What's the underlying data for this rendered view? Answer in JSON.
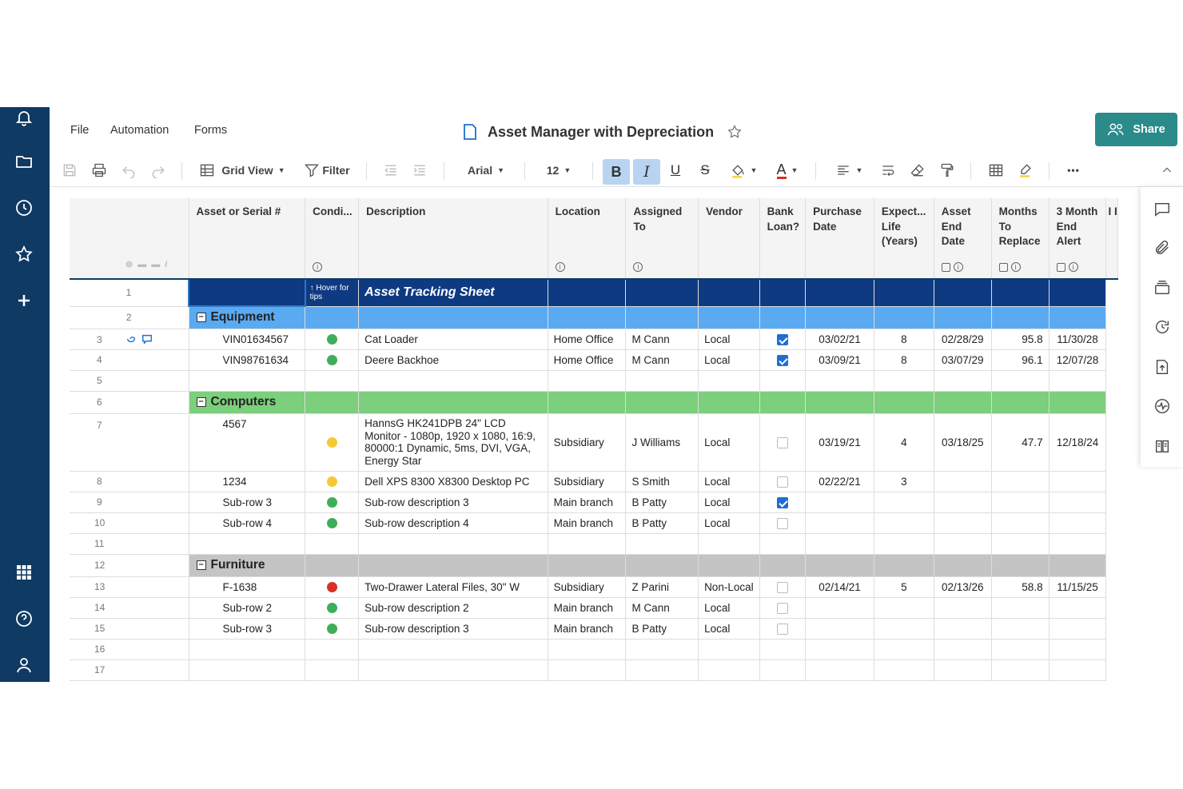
{
  "app": {
    "menu": [
      "File",
      "Automation",
      "Forms"
    ],
    "doc_title": "Asset Manager with Depreciation",
    "share_label": "Share"
  },
  "toolbar": {
    "view_label": "Grid View",
    "filter_label": "Filter",
    "font": "Arial",
    "font_size": "12",
    "bold": "B",
    "italic": "I",
    "underline": "U",
    "strike": "S",
    "text_color": "A",
    "more": "•••"
  },
  "columns": [
    "Asset or Serial #",
    "Condi...",
    "Description",
    "Location",
    "Assigned To",
    "Vendor",
    "Bank Loan?",
    "Purchase Date",
    "Expect... Life (Years)",
    "Asset End Date",
    "Months To Replace",
    "3 Month End Alert",
    "I I"
  ],
  "colors": {
    "nav_bg": "#0e3a63",
    "share_bg": "#2b8a8a",
    "title_row": "#0e3a82",
    "equipment": "#5aaaf2",
    "computers": "#7ccf7c",
    "furniture": "#c4c4c4",
    "green": "#3fae5a",
    "yellow": "#f5c933",
    "red": "#d93025"
  },
  "sheet": {
    "hover_tip": "↑ Hover for tips",
    "title": "Asset Tracking Sheet",
    "groups": {
      "equipment": "Equipment",
      "computers": "Computers",
      "furniture": "Furniture"
    },
    "rows": {
      "r3": {
        "asset": "VIN01634567",
        "cond": "green",
        "desc": "Cat Loader",
        "loc": "Home Office",
        "assigned": "M Cann",
        "vendor": "Local",
        "loan": true,
        "purchase": "03/02/21",
        "life": "8",
        "end": "02/28/29",
        "months": "95.8",
        "alert": "11/30/28"
      },
      "r4": {
        "asset": "VIN98761634",
        "cond": "green",
        "desc": "Deere Backhoe",
        "loc": "Home Office",
        "assigned": "M Cann",
        "vendor": "Local",
        "loan": true,
        "purchase": "03/09/21",
        "life": "8",
        "end": "03/07/29",
        "months": "96.1",
        "alert": "12/07/28"
      },
      "r7": {
        "asset": "4567",
        "cond": "yellow",
        "desc": "HannsG HK241DPB 24\" LCD Monitor - 1080p, 1920 x 1080, 16:9, 80000:1 Dynamic, 5ms, DVI, VGA, Energy Star",
        "loc": "Subsidiary",
        "assigned": "J Williams",
        "vendor": "Local",
        "loan": false,
        "purchase": "03/19/21",
        "life": "4",
        "end": "03/18/25",
        "months": "47.7",
        "alert": "12/18/24"
      },
      "r8": {
        "asset": "1234",
        "cond": "yellow",
        "desc": "Dell XPS 8300 X8300 Desktop PC",
        "loc": "Subsidiary",
        "assigned": "S Smith",
        "vendor": "Local",
        "loan": false,
        "purchase": "02/22/21",
        "life": "3"
      },
      "r9": {
        "asset": "Sub-row 3",
        "cond": "green",
        "desc": "Sub-row description 3",
        "loc": "Main branch",
        "assigned": "B Patty",
        "vendor": "Local",
        "loan": true
      },
      "r10": {
        "asset": "Sub-row 4",
        "cond": "green",
        "desc": "Sub-row description 4",
        "loc": "Main branch",
        "assigned": "B Patty",
        "vendor": "Local",
        "loan": false
      },
      "r13": {
        "asset": "F-1638",
        "cond": "red",
        "desc": "Two-Drawer Lateral Files, 30\" W",
        "loc": "Subsidiary",
        "assigned": "Z Parini",
        "vendor": "Non-Local",
        "loan": false,
        "purchase": "02/14/21",
        "life": "5",
        "end": "02/13/26",
        "months": "58.8",
        "alert": "11/15/25"
      },
      "r14": {
        "asset": "Sub-row 2",
        "cond": "green",
        "desc": "Sub-row description 2",
        "loc": "Main branch",
        "assigned": "M Cann",
        "vendor": "Local",
        "loan": false
      },
      "r15": {
        "asset": "Sub-row 3",
        "cond": "green",
        "desc": "Sub-row description 3",
        "loc": "Main branch",
        "assigned": "B Patty",
        "vendor": "Local",
        "loan": false
      }
    },
    "row_numbers": [
      "1",
      "2",
      "3",
      "4",
      "5",
      "6",
      "7",
      "8",
      "9",
      "10",
      "11",
      "12",
      "13",
      "14",
      "15",
      "16",
      "17"
    ]
  }
}
